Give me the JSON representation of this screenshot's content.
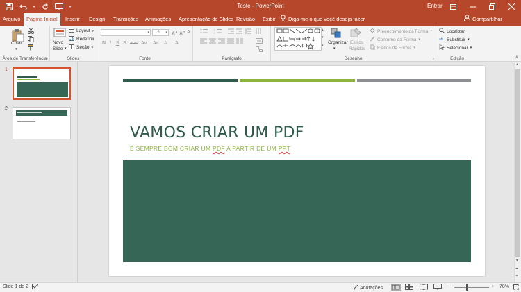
{
  "titlebar": {
    "document_title": "Teste - PowerPoint",
    "signin": "Entrar"
  },
  "tabs": [
    {
      "label": "Arquivo"
    },
    {
      "label": "Página Inicial"
    },
    {
      "label": "Inserir"
    },
    {
      "label": "Design"
    },
    {
      "label": "Transições"
    },
    {
      "label": "Animações"
    },
    {
      "label": "Apresentação de Slides"
    },
    {
      "label": "Revisão"
    },
    {
      "label": "Exibir"
    }
  ],
  "tell_me": "Diga-me o que você deseja fazer",
  "share": "Compartilhar",
  "ribbon": {
    "clipboard": {
      "paste": "Colar",
      "group": "Área de Transferência"
    },
    "slides": {
      "new_slide_1": "Novo",
      "new_slide_2": "Slide",
      "layout": "Layout",
      "reset": "Redefinir",
      "section": "Seção",
      "group": "Slides"
    },
    "font": {
      "font_size": "15",
      "group": "Fonte"
    },
    "paragraph": {
      "group": "Parágrafo"
    },
    "drawing": {
      "arrange": "Organizar",
      "quick_styles_1": "Estilos",
      "quick_styles_2": "Rápidos",
      "shape_fill": "Preenchimento da Forma",
      "shape_outline": "Contorno da Forma",
      "shape_effects": "Efeitos de Forma",
      "group": "Desenho"
    },
    "editing": {
      "find": "Localizar",
      "replace": "Substituir",
      "select": "Selecionar",
      "group": "Edição"
    }
  },
  "thumbnails": [
    {
      "number": "1"
    },
    {
      "number": "2"
    }
  ],
  "slide": {
    "title": "VAMOS CRIAR UM PDF",
    "subtitle_1": "É SEMPRE BOM CRIAR UM ",
    "subtitle_pdf": "PDF",
    "subtitle_2": " A PARTIR DE UM ",
    "subtitle_ppt": "PPT"
  },
  "colors": {
    "accent": "#b7472a",
    "slide_dark_green": "#2f5b4c",
    "slide_light_green": "#8db43f",
    "slide_gray": "#8c9093",
    "block_green": "#356656"
  },
  "statusbar": {
    "slide_info": "Slide 1 de 2",
    "notes": "Anotações",
    "zoom": "78%"
  }
}
